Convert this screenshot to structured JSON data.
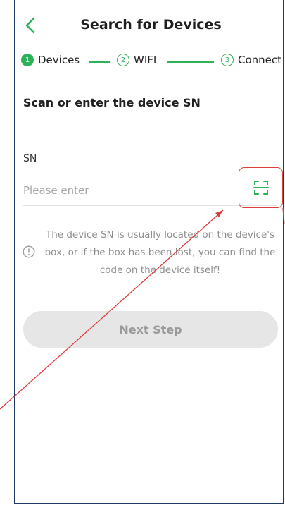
{
  "header": {
    "title": "Search for Devices",
    "back_icon": "chevron-left-icon"
  },
  "stepper": [
    {
      "number": "1",
      "label": "Devices",
      "state": "active"
    },
    {
      "number": "2",
      "label": "WIFI",
      "state": "pending"
    },
    {
      "number": "3",
      "label": "Connect",
      "state": "pending"
    }
  ],
  "main": {
    "heading": "Scan or enter the device SN",
    "sn_label": "SN",
    "sn_input": {
      "value": "",
      "placeholder": "Please enter"
    },
    "scan_icon": "scan-icon",
    "info_icon": "info-icon",
    "note": "The device SN is usually located on the device's box, or if the box has been lost, you can find the code on the device itself!",
    "next_button": "Next Step"
  },
  "colors": {
    "accent": "#2db25a",
    "highlight": "#e03b3b",
    "frame": "#1f3a6b",
    "disabled_button": "#e6e6e6"
  }
}
